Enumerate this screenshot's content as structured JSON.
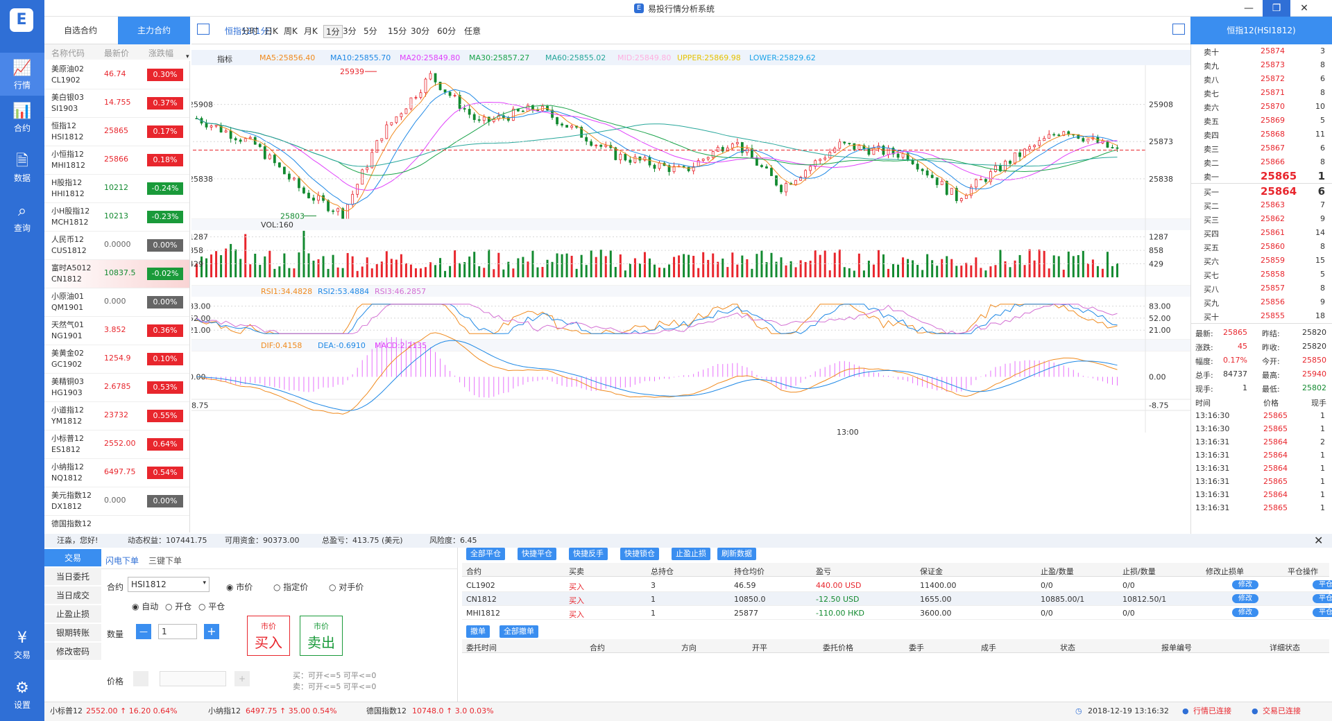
{
  "app": {
    "title": "易投行情分析系统",
    "logo": "E",
    "win_controls": [
      "—",
      "❐",
      "✕"
    ]
  },
  "sidebar": {
    "items": [
      {
        "label": "行情",
        "icon": "chart-line-icon",
        "glyph": "📈"
      },
      {
        "label": "合约",
        "icon": "bar-chart-icon",
        "glyph": "📊"
      },
      {
        "label": "数据",
        "icon": "document-icon",
        "glyph": "🗎"
      },
      {
        "label": "查询",
        "icon": "search-icon",
        "glyph": "⌕"
      },
      {
        "label": "交易",
        "icon": "yen-icon",
        "glyph": "¥"
      },
      {
        "label": "设置",
        "icon": "gear-icon",
        "glyph": "⚙"
      }
    ]
  },
  "tabs": [
    "自选合约",
    "主力合约"
  ],
  "watch": {
    "headers": [
      "名称代码",
      "最新价",
      "涨跌幅"
    ],
    "rows": [
      {
        "name": "美原油02",
        "code": "CL1902",
        "price": "46.74",
        "change": "0.30%",
        "dir": "up"
      },
      {
        "name": "美白银03",
        "code": "SI1903",
        "price": "14.755",
        "change": "0.37%",
        "dir": "up"
      },
      {
        "name": "恒指12",
        "code": "HSI1812",
        "price": "25865",
        "change": "0.17%",
        "dir": "up"
      },
      {
        "name": "小恒指12",
        "code": "MHI1812",
        "price": "25866",
        "change": "0.18%",
        "dir": "up"
      },
      {
        "name": "H股指12",
        "code": "HHI1812",
        "price": "10212",
        "change": "-0.24%",
        "dir": "down"
      },
      {
        "name": "小H股指12",
        "code": "MCH1812",
        "price": "10213",
        "change": "-0.23%",
        "dir": "down"
      },
      {
        "name": "人民币12",
        "code": "CUS1812",
        "price": "0.0000",
        "change": "0.00%",
        "dir": "flat"
      },
      {
        "name": "富时A5012",
        "code": "CN1812",
        "price": "10837.5",
        "change": "-0.02%",
        "dir": "down",
        "selected": true
      },
      {
        "name": "小原油01",
        "code": "QM1901",
        "price": "0.000",
        "change": "0.00%",
        "dir": "flat"
      },
      {
        "name": "天然气01",
        "code": "NG1901",
        "price": "3.852",
        "change": "0.36%",
        "dir": "up"
      },
      {
        "name": "美黄金02",
        "code": "GC1902",
        "price": "1254.9",
        "change": "0.10%",
        "dir": "up"
      },
      {
        "name": "美精铜03",
        "code": "HG1903",
        "price": "2.6785",
        "change": "0.53%",
        "dir": "up"
      },
      {
        "name": "小道指12",
        "code": "YM1812",
        "price": "23732",
        "change": "0.55%",
        "dir": "up"
      },
      {
        "name": "小标普12",
        "code": "ES1812",
        "price": "2552.00",
        "change": "0.64%",
        "dir": "up"
      },
      {
        "name": "小纳指12",
        "code": "NQ1812",
        "price": "6497.75",
        "change": "0.54%",
        "dir": "up"
      },
      {
        "name": "美元指数12",
        "code": "DX1812",
        "price": "0.000",
        "change": "0.00%",
        "dir": "flat"
      },
      {
        "name": "德国指数12",
        "code": "",
        "price": "",
        "change": "",
        "dir": "flat"
      }
    ]
  },
  "toolbar": {
    "contract": "恒指12(1分)",
    "periods": [
      "分时",
      "日K",
      "周K",
      "月K",
      "1分",
      "3分",
      "5分",
      "15分",
      "30分",
      "60分",
      "任意"
    ],
    "active_period": "1分"
  },
  "indicators": {
    "label": "指标",
    "ma": [
      "MA5:25856.40",
      "MA10:25855.70",
      "MA20:25849.80",
      "MA30:25857.27",
      "MA60:25855.02",
      "MID:25849.80",
      "UPPER:25869.98",
      "LOWER:25829.62"
    ],
    "ma_colors": [
      "#f08a1d",
      "#1e88e5",
      "#e040fb",
      "#1aa34a",
      "#26a69a",
      "#ffb0e0",
      "#e6c200",
      "#1aa3e8"
    ],
    "vol": "VOL:160",
    "rsi": [
      "RSI1:34.4828",
      "RSI2:53.4884",
      "RSI3:46.2857"
    ],
    "rsi_colors": [
      "#f08a1d",
      "#1e88e5",
      "#d36fd3"
    ],
    "macd": [
      "DIF:0.4158",
      "DEA:-0.6910",
      "MACD:2.2135"
    ],
    "macd_colors": [
      "#f08a1d",
      "#1e88e5",
      "#e040fb"
    ]
  },
  "axes": {
    "price_left": [
      "25908",
      "25838"
    ],
    "price_right": [
      "25908",
      "25873",
      "25838"
    ],
    "current": "25865",
    "high_mark": "25939",
    "low_mark": "25803",
    "vol": [
      "1287",
      "858",
      "429"
    ],
    "rsi": [
      "83.00",
      "52.00",
      "21.00"
    ],
    "macd": [
      "0.00",
      "-8.75"
    ],
    "time": "13:00"
  },
  "chart_data": {
    "type": "candlestick",
    "period": "1分",
    "current_price": 25865,
    "high": 25939,
    "low": 25803,
    "ylim_price": [
      25800,
      25945
    ],
    "vol_ticks": [
      429,
      858,
      1287
    ],
    "rsi_ticks": [
      21,
      52,
      83
    ],
    "macd_ticks": [
      -8.75,
      0
    ]
  },
  "orderbook": {
    "title": "恒指12(HSI1812)",
    "asks": [
      {
        "label": "卖十",
        "price": "25874",
        "vol": "3"
      },
      {
        "label": "卖九",
        "price": "25873",
        "vol": "8"
      },
      {
        "label": "卖八",
        "price": "25872",
        "vol": "6"
      },
      {
        "label": "卖七",
        "price": "25871",
        "vol": "8"
      },
      {
        "label": "卖六",
        "price": "25870",
        "vol": "10"
      },
      {
        "label": "卖五",
        "price": "25869",
        "vol": "5"
      },
      {
        "label": "卖四",
        "price": "25868",
        "vol": "11"
      },
      {
        "label": "卖三",
        "price": "25867",
        "vol": "6"
      },
      {
        "label": "卖二",
        "price": "25866",
        "vol": "8"
      },
      {
        "label": "卖一",
        "price": "25865",
        "vol": "1"
      }
    ],
    "bids": [
      {
        "label": "买一",
        "price": "25864",
        "vol": "6"
      },
      {
        "label": "买二",
        "price": "25863",
        "vol": "7"
      },
      {
        "label": "买三",
        "price": "25862",
        "vol": "9"
      },
      {
        "label": "买四",
        "price": "25861",
        "vol": "14"
      },
      {
        "label": "买五",
        "price": "25860",
        "vol": "8"
      },
      {
        "label": "买六",
        "price": "25859",
        "vol": "15"
      },
      {
        "label": "买七",
        "price": "25858",
        "vol": "5"
      },
      {
        "label": "买八",
        "price": "25857",
        "vol": "8"
      },
      {
        "label": "买九",
        "price": "25856",
        "vol": "9"
      },
      {
        "label": "买十",
        "price": "25855",
        "vol": "18"
      }
    ],
    "stats": [
      [
        "最新:",
        "25865",
        "昨结:",
        "25820"
      ],
      [
        "涨跌:",
        "45",
        "昨收:",
        "25820"
      ],
      [
        "幅度:",
        "0.17%",
        "今开:",
        "25850"
      ],
      [
        "总手:",
        "84737",
        "最高:",
        "25940"
      ],
      [
        "现手:",
        "1",
        "最低:",
        "25802"
      ]
    ],
    "ticks_header": [
      "时间",
      "价格",
      "现手"
    ],
    "ticks": [
      [
        "13:16:30",
        "25865",
        "1"
      ],
      [
        "13:16:30",
        "25865",
        "1"
      ],
      [
        "13:16:31",
        "25864",
        "2"
      ],
      [
        "13:16:31",
        "25864",
        "1"
      ],
      [
        "13:16:31",
        "25864",
        "1"
      ],
      [
        "13:16:31",
        "25865",
        "1"
      ],
      [
        "13:16:31",
        "25864",
        "1"
      ],
      [
        "13:16:31",
        "25865",
        "1"
      ]
    ]
  },
  "account": {
    "greet": "汪淼，您好!",
    "equity": "动态权益：107441.75",
    "available": "可用资金：90373.00",
    "pnl": "总盈亏：413.75  (美元)",
    "risk": "风险度：6.45"
  },
  "trade": {
    "nav": [
      "交易",
      "当日委托",
      "当日成交",
      "止盈止损",
      "银期转账",
      "修改密码"
    ],
    "subtabs": [
      "闪电下单",
      "三键下单"
    ],
    "contract_label": "合约",
    "contract_value": "HSI1812",
    "price_types": [
      "市价",
      "指定价",
      "对手价"
    ],
    "offset_types": [
      "自动",
      "开仓",
      "平仓"
    ],
    "qty_label": "数量",
    "qty_value": "1",
    "minus": "—",
    "plus": "+",
    "price_label": "价格",
    "buy": {
      "top": "市价",
      "main": "买入"
    },
    "sell": {
      "top": "市价",
      "main": "卖出"
    },
    "hint_buy": "买：可开<=5 可平<=0",
    "hint_sell": "卖：可开<=5 可平<=0"
  },
  "positions": {
    "buttons": [
      "全部平仓",
      "快捷平仓",
      "快捷反手",
      "快捷锁仓",
      "止盈止损",
      "刷新数据"
    ],
    "headers": [
      "合约",
      "买卖",
      "总持仓",
      "持仓均价",
      "盈亏",
      "保证金",
      "止盈/数量",
      "止损/数量",
      "修改止损单",
      "平仓操作"
    ],
    "rows": [
      {
        "contract": "CL1902",
        "side": "买入",
        "qty": "3",
        "avg": "46.59",
        "pnl": "440.00 USD",
        "pnl_dir": "up",
        "margin": "11400.00",
        "tp": "0/0",
        "sl": "0/0",
        "modify": "修改",
        "close": "平仓"
      },
      {
        "contract": "CN1812",
        "side": "买入",
        "qty": "1",
        "avg": "10850.0",
        "pnl": "-12.50 USD",
        "pnl_dir": "down",
        "margin": "1655.00",
        "tp": "10885.00/1",
        "sl": "10812.50/1",
        "modify": "修改",
        "close": "平仓"
      },
      {
        "contract": "MHI1812",
        "side": "买入",
        "qty": "1",
        "avg": "25877",
        "pnl": "-110.00 HKD",
        "pnl_dir": "down",
        "margin": "3600.00",
        "tp": "0/0",
        "sl": "0/0",
        "modify": "修改",
        "close": "平仓"
      }
    ]
  },
  "orders": {
    "buttons": [
      "撤单",
      "全部撤单"
    ],
    "headers": [
      "委托时间",
      "合约",
      "方向",
      "开平",
      "委托价格",
      "委手",
      "成手",
      "状态",
      "报单编号",
      "详细状态"
    ]
  },
  "status": {
    "tickers": [
      {
        "name": "小标普12",
        "text": "2552.00 ↑ 16.20 0.64%"
      },
      {
        "name": "小纳指12",
        "text": "6497.75 ↑ 35.00 0.54%"
      },
      {
        "name": "德国指数12",
        "text": "10748.0 ↑ 3.0 0.03%"
      }
    ],
    "datetime": "2018-12-19 13:16:32",
    "quote_conn": "行情已连接",
    "trade_conn": "交易已连接"
  },
  "colors": {
    "accent": "#2f6fd6",
    "tab_active": "#3a8ef0",
    "up": "#e8262d",
    "down": "#138a30"
  }
}
